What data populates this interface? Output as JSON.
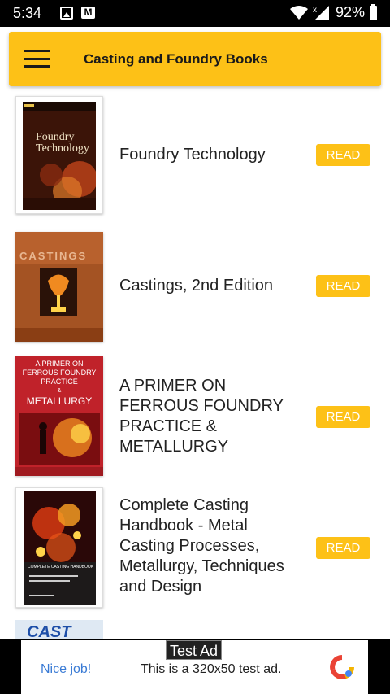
{
  "status_bar": {
    "time": "5:34",
    "battery": "92%"
  },
  "app_bar": {
    "title": "Casting and Foundry Books"
  },
  "books": [
    {
      "title": "Foundry Technology",
      "read_label": "READ",
      "cover_text": [
        "Foundry",
        "Technology"
      ]
    },
    {
      "title": "Castings, 2nd Edition",
      "read_label": "READ",
      "cover_text": [
        "CASTINGS"
      ]
    },
    {
      "title": "A PRIMER ON FERROUS FOUNDRY PRACTICE & METALLURGY",
      "read_label": "READ",
      "cover_text": [
        "A PRIMER ON",
        "FERROUS FOUNDRY",
        "PRACTICE",
        "&",
        "METALLURGY"
      ]
    },
    {
      "title": "Complete Casting Handbook - Metal Casting Processes, Metallurgy, Techniques and Design",
      "read_label": "READ",
      "cover_text": [
        "COMPLETE CASTING HANDBOOK"
      ]
    },
    {
      "cover_text": [
        "CAST IRON"
      ]
    }
  ],
  "ad": {
    "label": "Test Ad",
    "headline": "Nice job!",
    "body": "This is a 320x50 test ad."
  },
  "colors": {
    "accent": "#fdc117",
    "status_bar": "#000000"
  }
}
